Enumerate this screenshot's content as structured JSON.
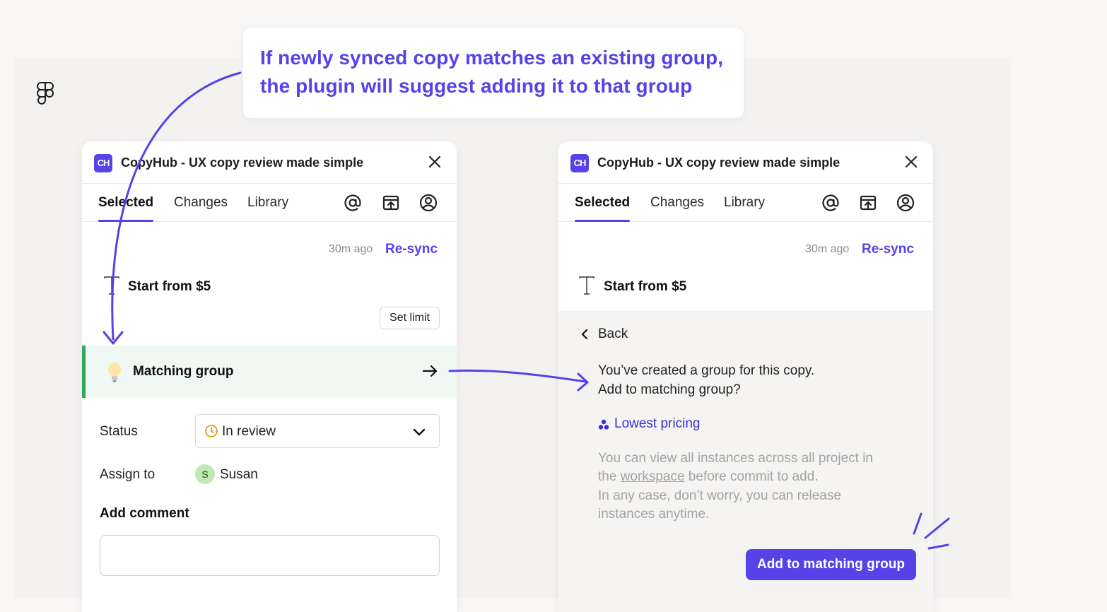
{
  "colors": {
    "accent": "#5543e8",
    "match_bar": "#2ea85a",
    "match_bg": "#f0f8f4"
  },
  "callout": {
    "line1": "If newly synced copy matches an existing group,",
    "line2": "the plugin will suggest adding it to that group"
  },
  "left_panel": {
    "logo": "CH",
    "title": "CopyHub - UX copy review made simple",
    "tabs": [
      "Selected",
      "Changes",
      "Library"
    ],
    "sync_time": "30m ago",
    "resync": "Re-sync",
    "copy_text": "Start from $5",
    "set_limit": "Set limit",
    "matching_group": "Matching group",
    "status_label": "Status",
    "status_value": "In review",
    "assign_label": "Assign to",
    "assignee_initial": "S",
    "assignee": "Susan",
    "add_comment": "Add comment"
  },
  "right_panel": {
    "logo": "CH",
    "title": "CopyHub - UX copy review made simple",
    "tabs": [
      "Selected",
      "Changes",
      "Library"
    ],
    "sync_time": "30m ago",
    "resync": "Re-sync",
    "copy_text": "Start from $5",
    "back": "Back",
    "message_line1": "You’ve created a group for this copy.",
    "message_line2": "Add to matching group?",
    "group_name": "Lowest pricing",
    "note_line1": "You can view all instances across all project in",
    "note_line2_pre": "the ",
    "note_line2_link": "workspace",
    "note_line2_post": " before commit to add.",
    "note_line3": "In any case, don’t worry, you can release",
    "note_line4": "instances anytime.",
    "add_button": "Add to matching group"
  }
}
